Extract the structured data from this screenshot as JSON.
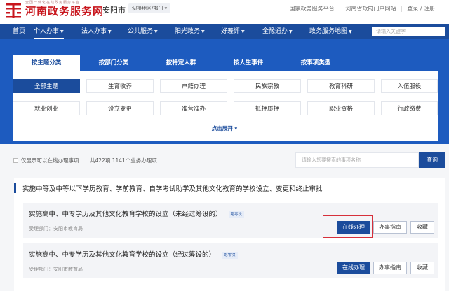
{
  "header": {
    "logo_sub": "全国一体化在线政务服务平台",
    "logo_title": "河南政务服务网",
    "city": "安阳市",
    "switch_label": "切换地区/部门",
    "links": [
      "国家政务服务平台",
      "河南省政府门户网站",
      "登录 / 注册"
    ]
  },
  "nav": {
    "items": [
      "首页",
      "个人办事",
      "法人办事",
      "公共服务",
      "阳光政务",
      "好差评",
      "全豫通办",
      "政务服务地图"
    ],
    "active_index": 1,
    "search_placeholder": "请输入关键字"
  },
  "tabs": [
    "按主题分类",
    "按部门分类",
    "按特定人群",
    "按人生事件",
    "按事项类型"
  ],
  "categories": [
    [
      "全部主题",
      "生育收养",
      "户籍办理",
      "民族宗教",
      "教育科研",
      "入伍服役"
    ],
    [
      "就业创业",
      "设立变更",
      "准营准办",
      "抵押质押",
      "职业资格",
      "行政缴费"
    ]
  ],
  "expand_label": "点击展开",
  "filter": {
    "checkbox_label": "仅显示可以在线办理事项",
    "count_text": "共422项 1141个业务办理项",
    "search_placeholder": "请输入您要搜索的事项名称",
    "search_button": "查询"
  },
  "list": {
    "group_title": "实施中等及中等以下学历教育、学前教育、自学考试助学及其他文化教育的学校设立、变更和终止审批",
    "items": [
      {
        "name": "实施高中、中专学历及其他文化教育学校的设立（未经过筹设的）",
        "badge": "跑零次",
        "dept": "受理部门：安阳市教育局",
        "btn_online": "在线办理",
        "btn_guide": "办事指南",
        "btn_fav": "收藏"
      },
      {
        "name": "实施高中、中专学历及其他文化教育学校的设立（经过筹设的）",
        "badge": "跑零次",
        "dept": "受理部门：安阳市教育局",
        "btn_online": "在线办理",
        "btn_guide": "办事指南",
        "btn_fav": "收藏"
      }
    ]
  },
  "colors": {
    "brand_red": "#c8161d",
    "nav_blue": "#1b4c9c",
    "banner_blue": "#1d5bbf",
    "highlight_red": "#d6303b"
  }
}
